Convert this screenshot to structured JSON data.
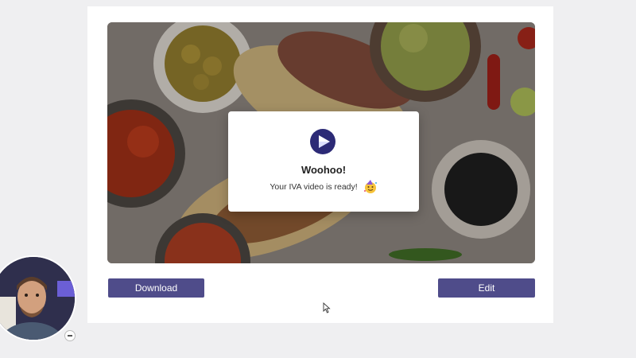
{
  "modal": {
    "title": "Woohoo!",
    "message": "Your IVA video is ready!",
    "logo_icon": "play-logo-icon",
    "emoji_icon": "party-face-emoji"
  },
  "actions": {
    "download_label": "Download",
    "edit_label": "Edit"
  },
  "colors": {
    "button": "#4f4c8a",
    "logo": "#2c2a76",
    "page_background": "#efeff1"
  },
  "webcam": {
    "minimize_icon": "minimize-icon"
  }
}
